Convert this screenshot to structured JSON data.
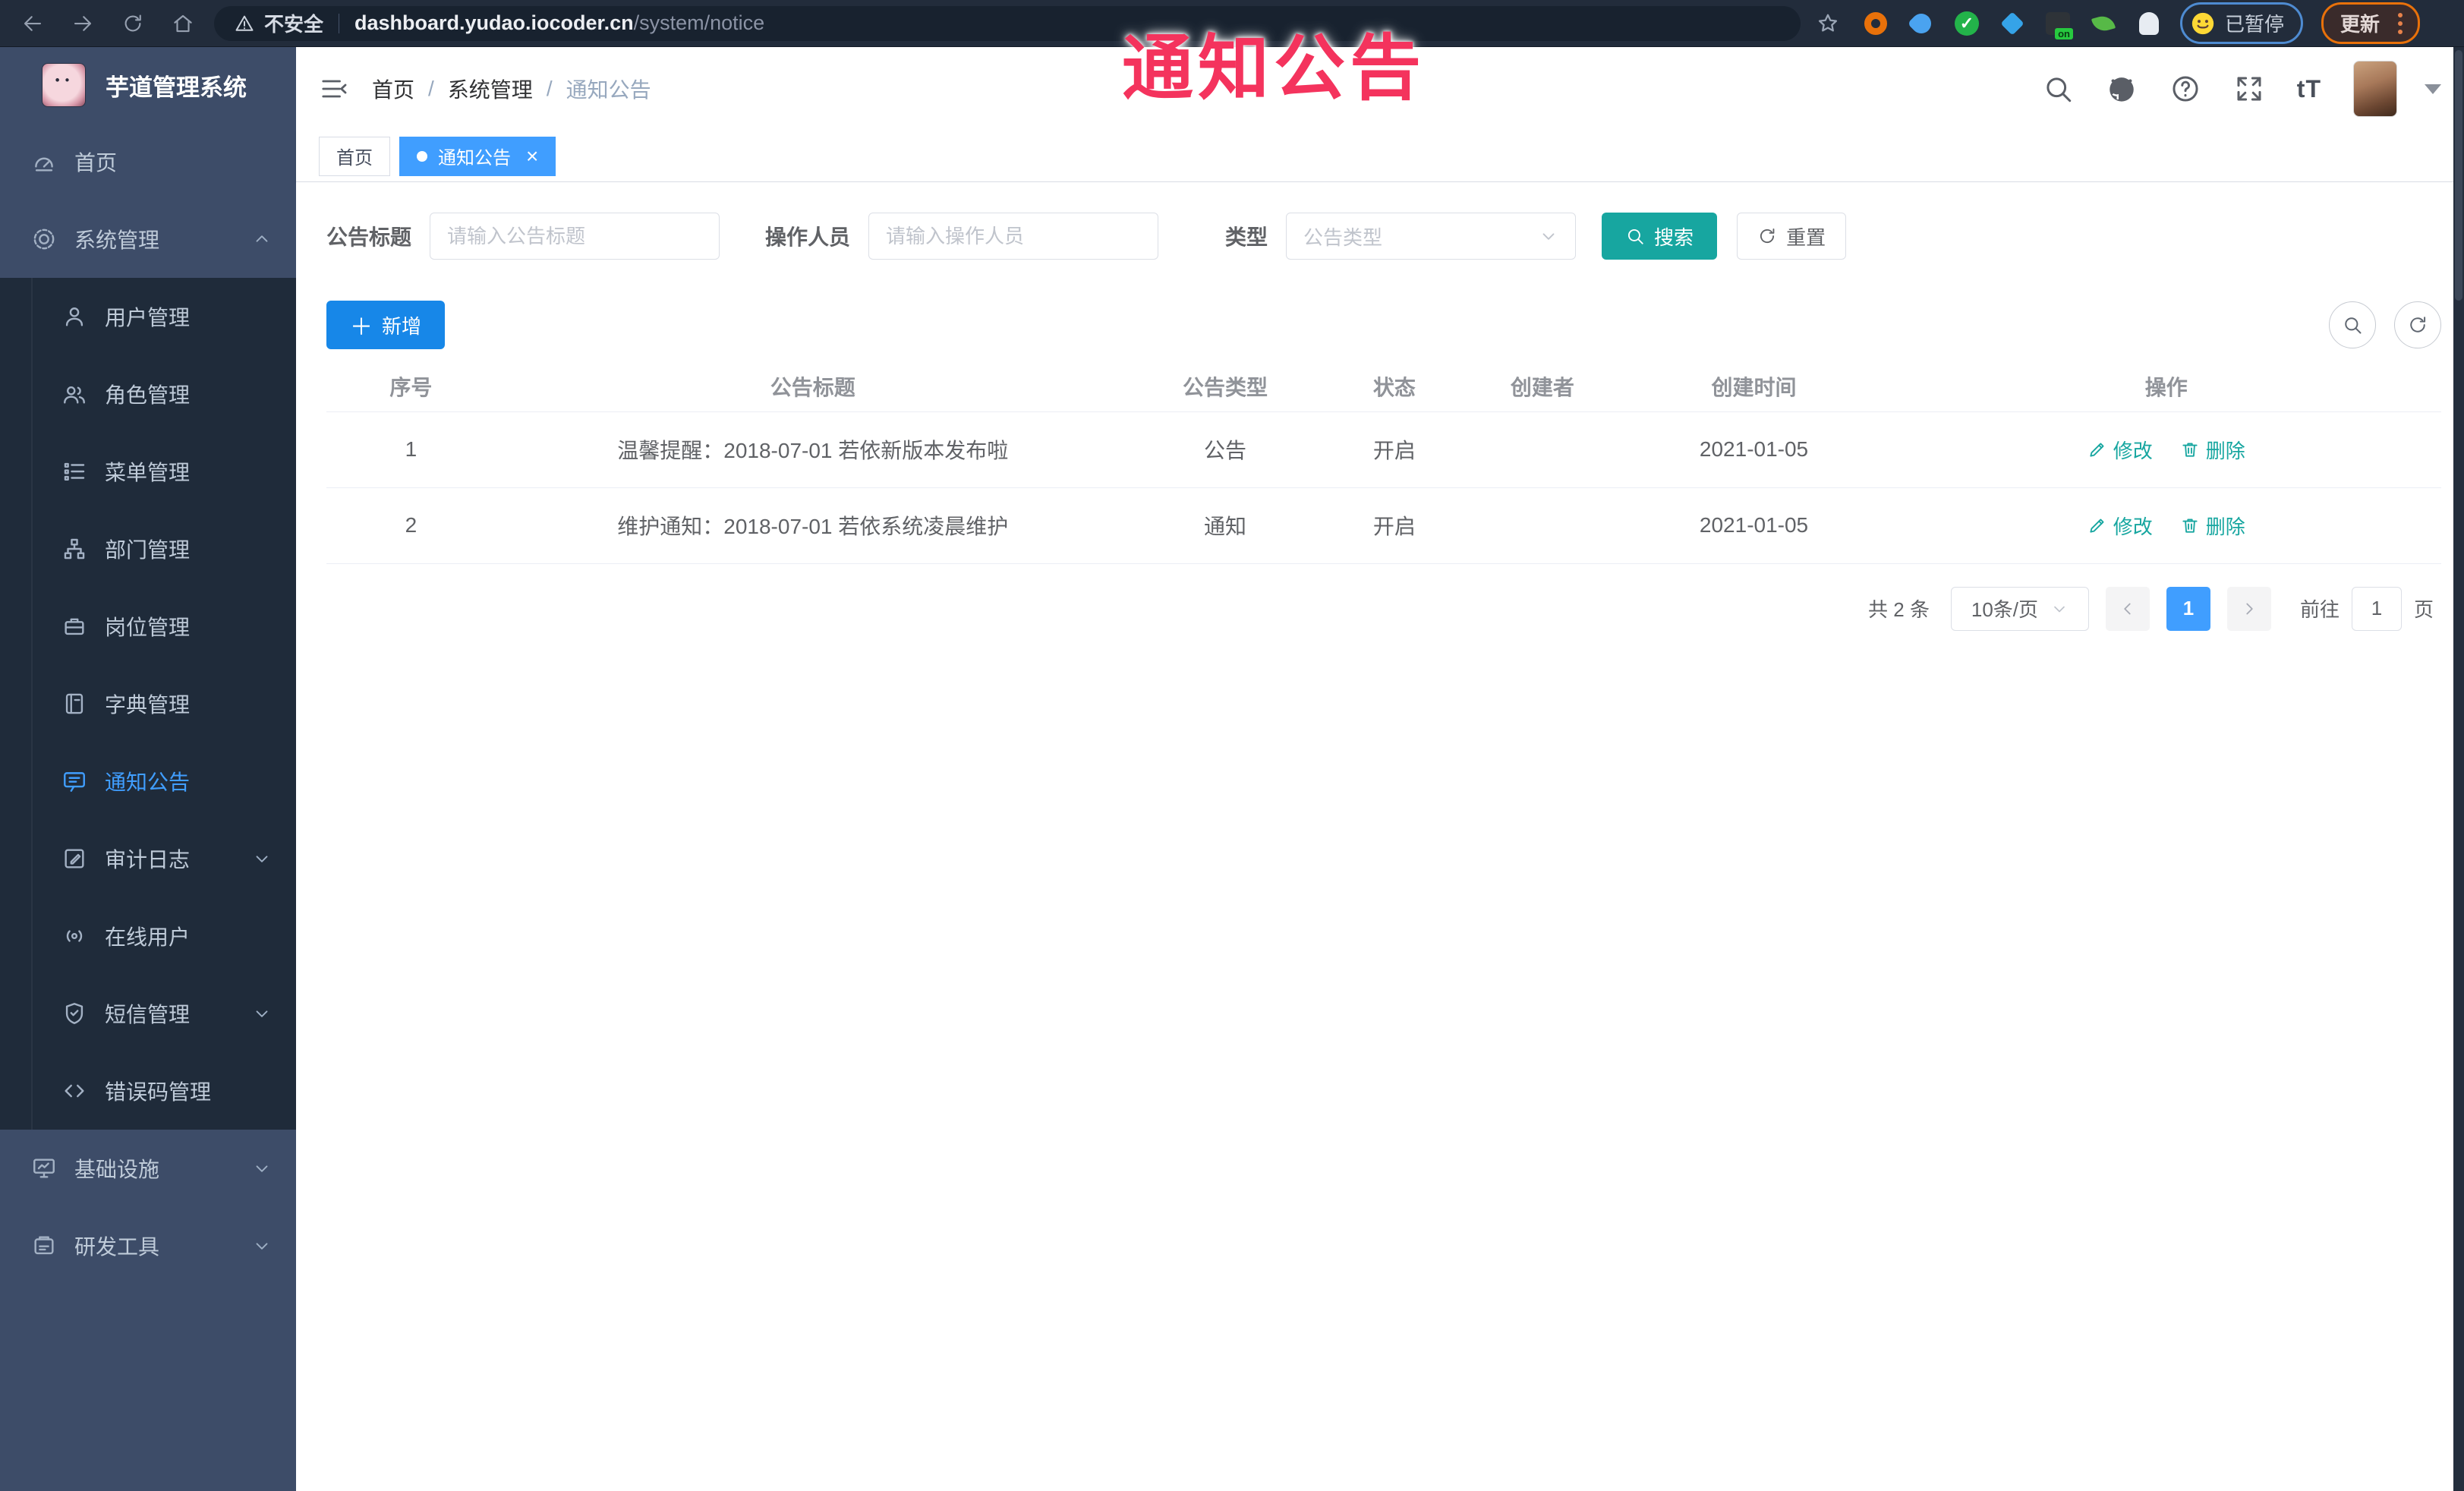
{
  "browser": {
    "security_label": "不安全",
    "url_domain": "dashboard.yudao.iocoder.cn",
    "url_path": "/system/notice",
    "paused_label": "已暂停",
    "update_label": "更新"
  },
  "annotation": {
    "text": "通知公告",
    "color": "#f4335d"
  },
  "sidebar": {
    "title": "芋道管理系统",
    "items": [
      {
        "label": "首页",
        "icon": "dashboard-icon"
      },
      {
        "label": "系统管理",
        "icon": "gear-icon",
        "state": "expanded"
      },
      {
        "label": "用户管理",
        "icon": "user-icon"
      },
      {
        "label": "角色管理",
        "icon": "users-icon"
      },
      {
        "label": "菜单管理",
        "icon": "menu-list-icon"
      },
      {
        "label": "部门管理",
        "icon": "org-tree-icon"
      },
      {
        "label": "岗位管理",
        "icon": "briefcase-icon"
      },
      {
        "label": "字典管理",
        "icon": "book-icon"
      },
      {
        "label": "通知公告",
        "icon": "message-icon",
        "state": "active"
      },
      {
        "label": "审计日志",
        "icon": "log-icon",
        "state": "collapsed"
      },
      {
        "label": "在线用户",
        "icon": "online-icon"
      },
      {
        "label": "短信管理",
        "icon": "shield-check-icon",
        "state": "collapsed"
      },
      {
        "label": "错误码管理",
        "icon": "code-icon"
      },
      {
        "label": "基础设施",
        "icon": "monitor-icon",
        "state": "collapsed"
      },
      {
        "label": "研发工具",
        "icon": "toolbox-icon",
        "state": "collapsed"
      }
    ]
  },
  "header": {
    "breadcrumb": [
      "首页",
      "系统管理",
      "通知公告"
    ],
    "separator": "/"
  },
  "tabs": [
    {
      "label": "首页",
      "active": false
    },
    {
      "label": "通知公告",
      "active": true
    }
  ],
  "filters": {
    "title_label": "公告标题",
    "title_placeholder": "请输入公告标题",
    "operator_label": "操作人员",
    "operator_placeholder": "请输入操作人员",
    "type_label": "类型",
    "type_placeholder": "公告类型",
    "search_label": "搜索",
    "reset_label": "重置"
  },
  "toolbar": {
    "add_label": "新增"
  },
  "table": {
    "columns": [
      "序号",
      "公告标题",
      "公告类型",
      "状态",
      "创建者",
      "创建时间",
      "操作"
    ],
    "rows": [
      {
        "no": "1",
        "title": "温馨提醒：2018-07-01 若依新版本发布啦",
        "type": "公告",
        "status": "开启",
        "creator": "",
        "created": "2021-01-05"
      },
      {
        "no": "2",
        "title": "维护通知：2018-07-01 若依系统凌晨维护",
        "type": "通知",
        "status": "开启",
        "creator": "",
        "created": "2021-01-05"
      }
    ],
    "edit_label": "修改",
    "delete_label": "删除"
  },
  "pagination": {
    "total": "共 2 条",
    "page_size": "10条/页",
    "current_page": "1",
    "goto_label": "前往",
    "goto_value": "1",
    "page_unit": "页"
  },
  "colors": {
    "accent_blue": "#409eff",
    "accent_teal": "#17a6a0",
    "add_button_blue": "#1787e8",
    "annotation_red": "#f4335d",
    "sidebar_bg": "#3d4c68",
    "submenu_bg": "#1f2b3a",
    "browser_bar_bg": "#222c3b"
  }
}
